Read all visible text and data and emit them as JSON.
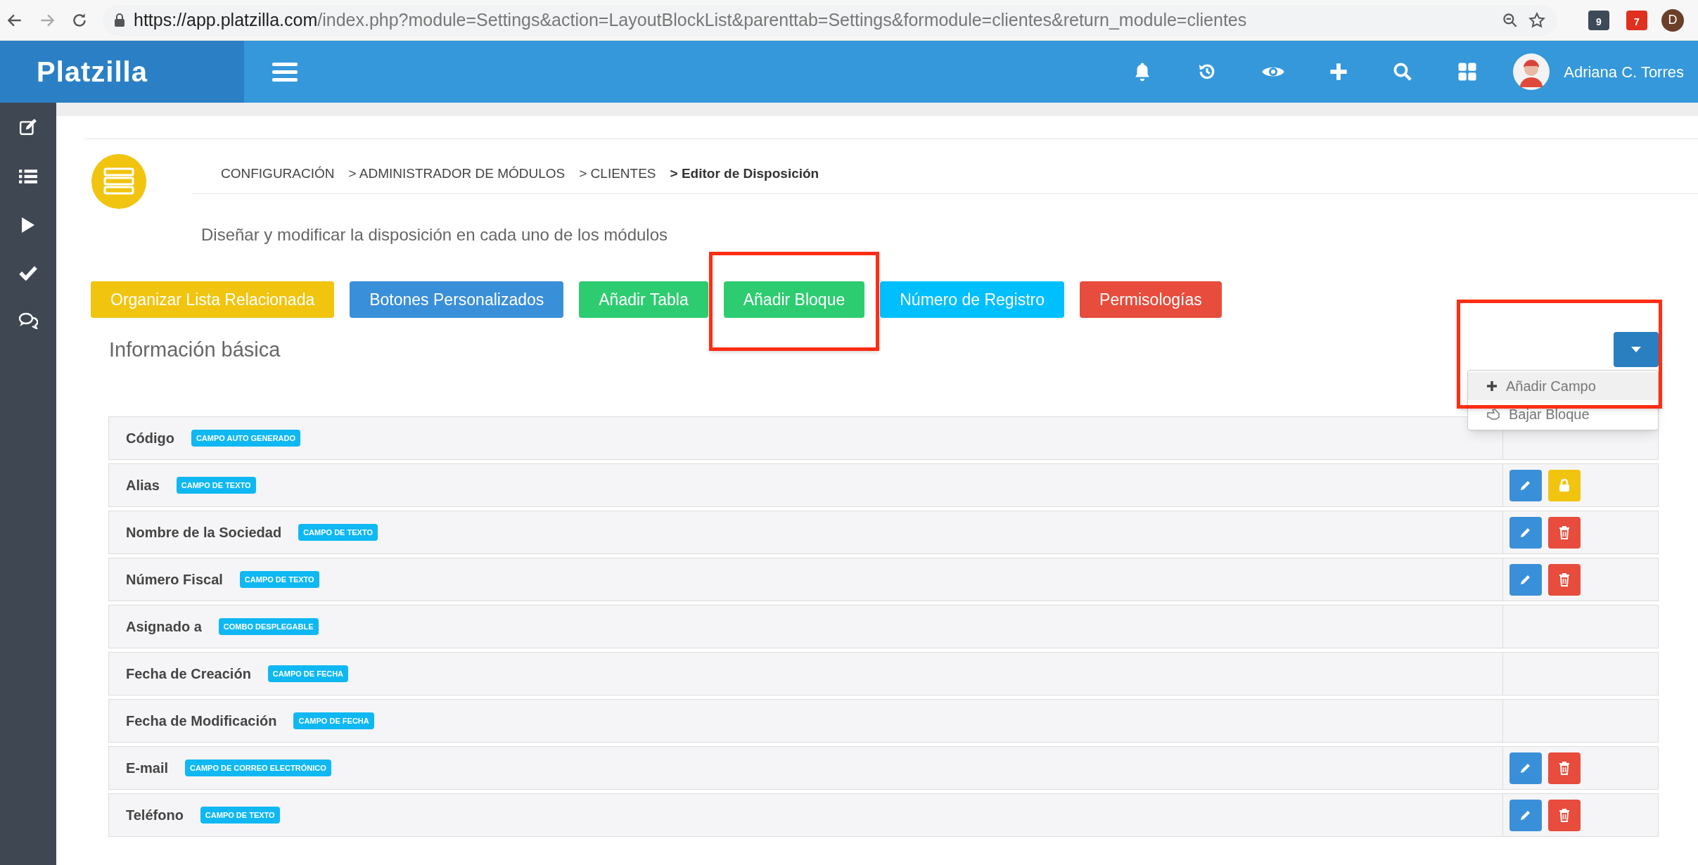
{
  "browser": {
    "url_origin": "https://app.platzilla.com",
    "url_rest": "/index.php?module=Settings&action=LayoutBlockList&parenttab=Settings&formodule=clientes&return_module=clientes",
    "extensions": [
      {
        "label": "9",
        "kind": "dark"
      },
      {
        "label": "7",
        "kind": "red"
      }
    ],
    "profile": "D"
  },
  "header": {
    "logo": "Platzilla",
    "user": "Adriana C. Torres"
  },
  "breadcrumb": [
    {
      "label": "CONFIGURACIÓN",
      "current": false
    },
    {
      "label": "> ADMINISTRADOR DE MÓDULOS",
      "current": false
    },
    {
      "label": "> CLIENTES",
      "current": false
    },
    {
      "label": "> Editor de Disposición",
      "current": true
    }
  ],
  "subtitle": "Diseñar y modificar la disposición en cada uno de los módulos",
  "toolbar": [
    {
      "label": "Organizar Lista Relacionada",
      "color": "#f1c40f",
      "highlighted": false
    },
    {
      "label": "Botones Personalizados",
      "color": "#3a8fd9",
      "highlighted": false
    },
    {
      "label": "Añadir Tabla",
      "color": "#2ecc71",
      "highlighted": false
    },
    {
      "label": "Añadir Bloque",
      "color": "#2ecc71",
      "highlighted": true
    },
    {
      "label": "Número de Registro",
      "color": "#00bfff",
      "highlighted": false
    },
    {
      "label": "Permisologías",
      "color": "#e74c3c",
      "highlighted": false
    }
  ],
  "block": {
    "title": "Información básica",
    "menu_highlighted": true,
    "menu": [
      {
        "label": "Añadir Campo",
        "kind": "add",
        "selected": true
      },
      {
        "label": "Bajar Bloque",
        "kind": "down",
        "selected": false
      }
    ]
  },
  "rows": [
    {
      "label": "Código",
      "badge": "CAMPO AUTO GENERADO",
      "actions": []
    },
    {
      "label": "Alias",
      "badge": "CAMPO DE TEXTO",
      "actions": [
        {
          "kind": "edit"
        },
        {
          "kind": "lock"
        }
      ]
    },
    {
      "label": "Nombre de la Sociedad",
      "badge": "CAMPO DE TEXTO",
      "actions": [
        {
          "kind": "edit"
        },
        {
          "kind": "delete"
        }
      ]
    },
    {
      "label": "Número Fiscal",
      "badge": "CAMPO DE TEXTO",
      "actions": [
        {
          "kind": "edit"
        },
        {
          "kind": "delete"
        }
      ]
    },
    {
      "label": "Asignado a",
      "badge": "COMBO DESPLEGABLE",
      "actions": []
    },
    {
      "label": "Fecha de Creación",
      "badge": "CAMPO DE FECHA",
      "actions": []
    },
    {
      "label": "Fecha de Modificación",
      "badge": "CAMPO DE FECHA",
      "actions": []
    },
    {
      "label": "E-mail",
      "badge": "CAMPO DE CORREO ELECTRÓNICO",
      "actions": [
        {
          "kind": "edit"
        },
        {
          "kind": "delete"
        }
      ]
    },
    {
      "label": "Teléfono",
      "badge": "CAMPO DE TEXTO",
      "actions": [
        {
          "kind": "edit"
        },
        {
          "kind": "delete"
        }
      ]
    }
  ]
}
